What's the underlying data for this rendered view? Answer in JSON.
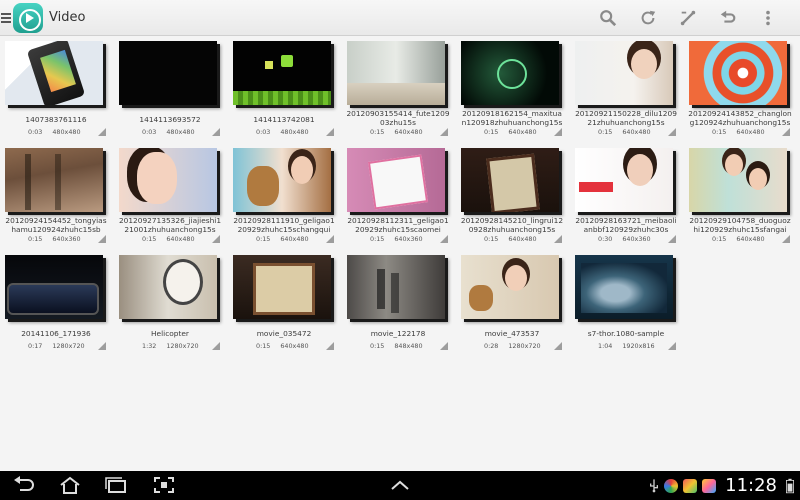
{
  "app": {
    "title": "Video"
  },
  "toolbar": {
    "actions": [
      {
        "name": "search-button",
        "icon": "search-icon"
      },
      {
        "name": "refresh-button",
        "icon": "refresh-icon"
      },
      {
        "name": "edit-button",
        "icon": "edit-icon"
      },
      {
        "name": "back-action-button",
        "icon": "undo-icon"
      },
      {
        "name": "overflow-menu-button",
        "icon": "more-vert-icon"
      }
    ]
  },
  "videos": [
    {
      "title": "1407383761116",
      "duration": "0:03",
      "resolution": "480x480",
      "scene": "s-phone"
    },
    {
      "title": "1414113693572",
      "duration": "0:03",
      "resolution": "480x480",
      "scene": "s-black"
    },
    {
      "title": "1414113742081",
      "duration": "0:03",
      "resolution": "480x480",
      "scene": "s-game"
    },
    {
      "title": "20120903155414_fute120903zhu15s",
      "duration": "0:15",
      "resolution": "640x480",
      "scene": "s-room"
    },
    {
      "title": "20120918162154_maxituan120918zhuhuanchong15s",
      "duration": "0:15",
      "resolution": "640x480",
      "scene": "s-dark-grn"
    },
    {
      "title": "20120921150228_dilu120921zhuhuanchong15s",
      "duration": "0:15",
      "resolution": "640x480",
      "scene": "s-girl"
    },
    {
      "title": "20120924143852_changlong120924zhuhuanchong15s",
      "duration": "0:15",
      "resolution": "640x480",
      "scene": "s-spiral"
    },
    {
      "title": "20120924154452_tongyiashamu120924zhuhc15sb",
      "duration": "0:15",
      "resolution": "640x360",
      "scene": "s-wood"
    },
    {
      "title": "20120927135326_jiajieshi121001zhuhuanchong15s",
      "duration": "0:15",
      "resolution": "640x480",
      "scene": "s-face"
    },
    {
      "title": "20120928111910_geligao120929zhuhc15schangqui",
      "duration": "0:15",
      "resolution": "640x480",
      "scene": "s-bear"
    },
    {
      "title": "20120928112311_geligao120929zhuhc15scaomei",
      "duration": "0:15",
      "resolution": "640x360",
      "scene": "s-card"
    },
    {
      "title": "20120928145210_lingrui120928zhuhuanchong15s",
      "duration": "0:15",
      "resolution": "640x480",
      "scene": "s-tv"
    },
    {
      "title": "20120928163721_meibaolianbbf120929zhuhc30s",
      "duration": "0:30",
      "resolution": "640x360",
      "scene": "s-portrait"
    },
    {
      "title": "20120929104758_duoguozhi120929zhuhc15sfangai",
      "duration": "0:15",
      "resolution": "640x480",
      "scene": "s-store"
    },
    {
      "title": "20141106_171936",
      "duration": "0:17",
      "resolution": "1280x720",
      "scene": "s-night"
    },
    {
      "title": "Helicopter",
      "duration": "1:32",
      "resolution": "1280x720",
      "scene": "s-robot"
    },
    {
      "title": "movie_035472",
      "duration": "0:15",
      "resolution": "640x480",
      "scene": "s-tv2"
    },
    {
      "title": "movie_122178",
      "duration": "0:15",
      "resolution": "848x480",
      "scene": "s-fog"
    },
    {
      "title": "movie_473537",
      "duration": "0:28",
      "resolution": "1280x720",
      "scene": "s-sofa"
    },
    {
      "title": "s7-thor.1080-sample",
      "duration": "1:04",
      "resolution": "1920x816",
      "scene": "s-sea"
    }
  ],
  "navbar": {
    "buttons": [
      "back-icon",
      "home-icon",
      "recent-apps-icon",
      "screenshot-icon"
    ],
    "expand_icon": "chevron-up-icon"
  },
  "status": {
    "time": "11:28",
    "icons": [
      "usb-icon",
      "app-notification-icon",
      "gallery-notification-icon",
      "photo-notification-icon",
      "battery-icon"
    ]
  }
}
